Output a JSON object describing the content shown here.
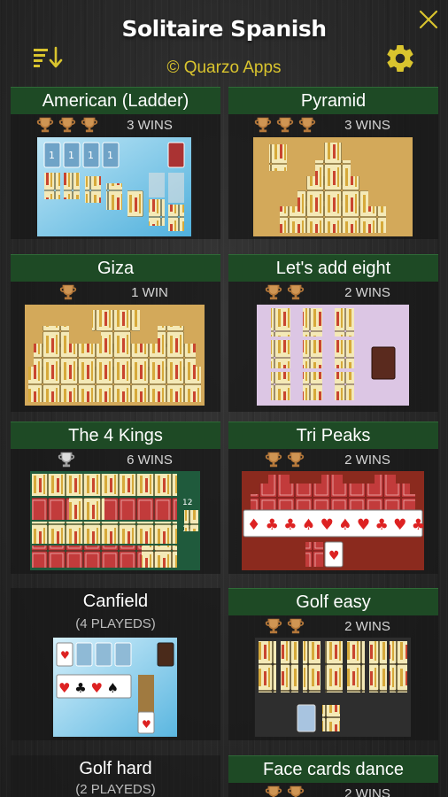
{
  "app": {
    "title": "Solitaire Spanish",
    "subtitle": "© Quarzo Apps"
  },
  "icons": {
    "close": "close-icon",
    "sort": "sort-icon",
    "settings": "gear-icon",
    "trophy": "trophy-icon"
  },
  "colors": {
    "accent": "#d9c42e",
    "card_header": "#1e4a25",
    "bronze": "#b07a3a",
    "silver": "#b8b8b8"
  },
  "games": [
    {
      "title": "American (Ladder)",
      "stat": "3 WINS",
      "trophies": 3,
      "trophy_type": "bronze"
    },
    {
      "title": "Pyramid",
      "stat": "3 WINS",
      "trophies": 3,
      "trophy_type": "bronze"
    },
    {
      "title": "Giza",
      "stat": "1 WIN",
      "trophies": 1,
      "trophy_type": "bronze"
    },
    {
      "title": "Let's add eight",
      "stat": "2 WINS",
      "trophies": 2,
      "trophy_type": "bronze"
    },
    {
      "title": "The 4 Kings",
      "stat": "6 WINS",
      "trophies": 1,
      "trophy_type": "silver"
    },
    {
      "title": "Tri Peaks",
      "stat": "2 WINS",
      "trophies": 2,
      "trophy_type": "bronze"
    },
    {
      "title": "Canfield",
      "stat": "(4 PLAYEDS)",
      "trophies": 0,
      "trophy_type": "none"
    },
    {
      "title": "Golf easy",
      "stat": "2 WINS",
      "trophies": 2,
      "trophy_type": "bronze"
    },
    {
      "title": "Golf hard",
      "stat": "(2 PLAYEDS)",
      "trophies": 0,
      "trophy_type": "none"
    },
    {
      "title": "Face cards dance",
      "stat": "2 WINS",
      "trophies": 2,
      "trophy_type": "bronze"
    }
  ]
}
